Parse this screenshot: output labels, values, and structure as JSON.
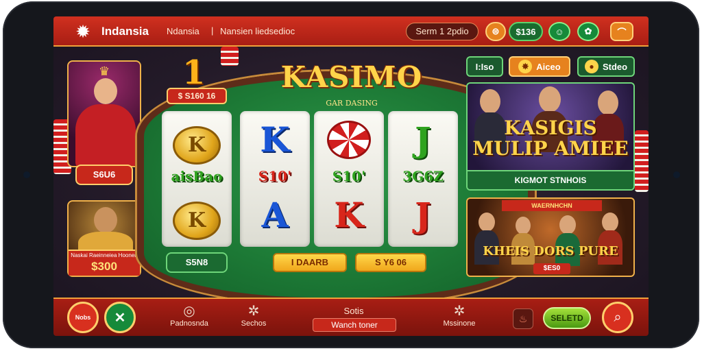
{
  "header": {
    "brand": "Indansia",
    "nav_primary": "Ndansia",
    "nav_separator": "|",
    "nav_secondary": "Nansien liedsedioc",
    "user_pill": "Serm 1 2pdio",
    "balance": "$136",
    "coin_icon": "coin-icon",
    "menu_icon": "menu-icon"
  },
  "table": {
    "title": "KASIMO",
    "subtitle": "GAR DASING",
    "big_number": "1",
    "pot_badge": "$ S160 16",
    "reels": [
      {
        "top": "K",
        "middle": "aisBao",
        "bottom": "K"
      },
      {
        "top": "K",
        "middle": "S10'",
        "bottom": "A"
      },
      {
        "top": "chip",
        "middle": "S10'",
        "bottom": "K"
      },
      {
        "top": "J",
        "middle": "3G6Z",
        "bottom": "J"
      }
    ],
    "btn_green": "S5N8",
    "btn_gold_1": "I DAARB",
    "btn_gold_2": "S Y6 06"
  },
  "left": {
    "dancer_badge": "S6U6",
    "man_label_small": "Naskai Raeinneiea Hoonen",
    "man_label_big": "$300"
  },
  "right": {
    "tab1": "I:Iso",
    "tab2": "Aiceo",
    "tab3": "Stdeo",
    "promo1_title": "KASIGIS MULIP AMIEE",
    "promo1_footer": "KIGMOT STNHOIS",
    "promo2_ribbon": "WAERNHCHN",
    "promo2_title": "KHEIS DORS PURE",
    "promo2_price": "$ES0"
  },
  "bottom": {
    "home_label": "Nobs",
    "nav1_label": "Padnosnda",
    "nav2_label": "Sechos",
    "center_title": "Sotis",
    "center_field": "Wanch toner",
    "nav3_label": "Mssinone",
    "select_label": "SELETD"
  },
  "colors": {
    "header_red": "#c7281b",
    "felt_green": "#1d7a36",
    "gold": "#ffd44a",
    "accent_orange": "#e6821e"
  }
}
